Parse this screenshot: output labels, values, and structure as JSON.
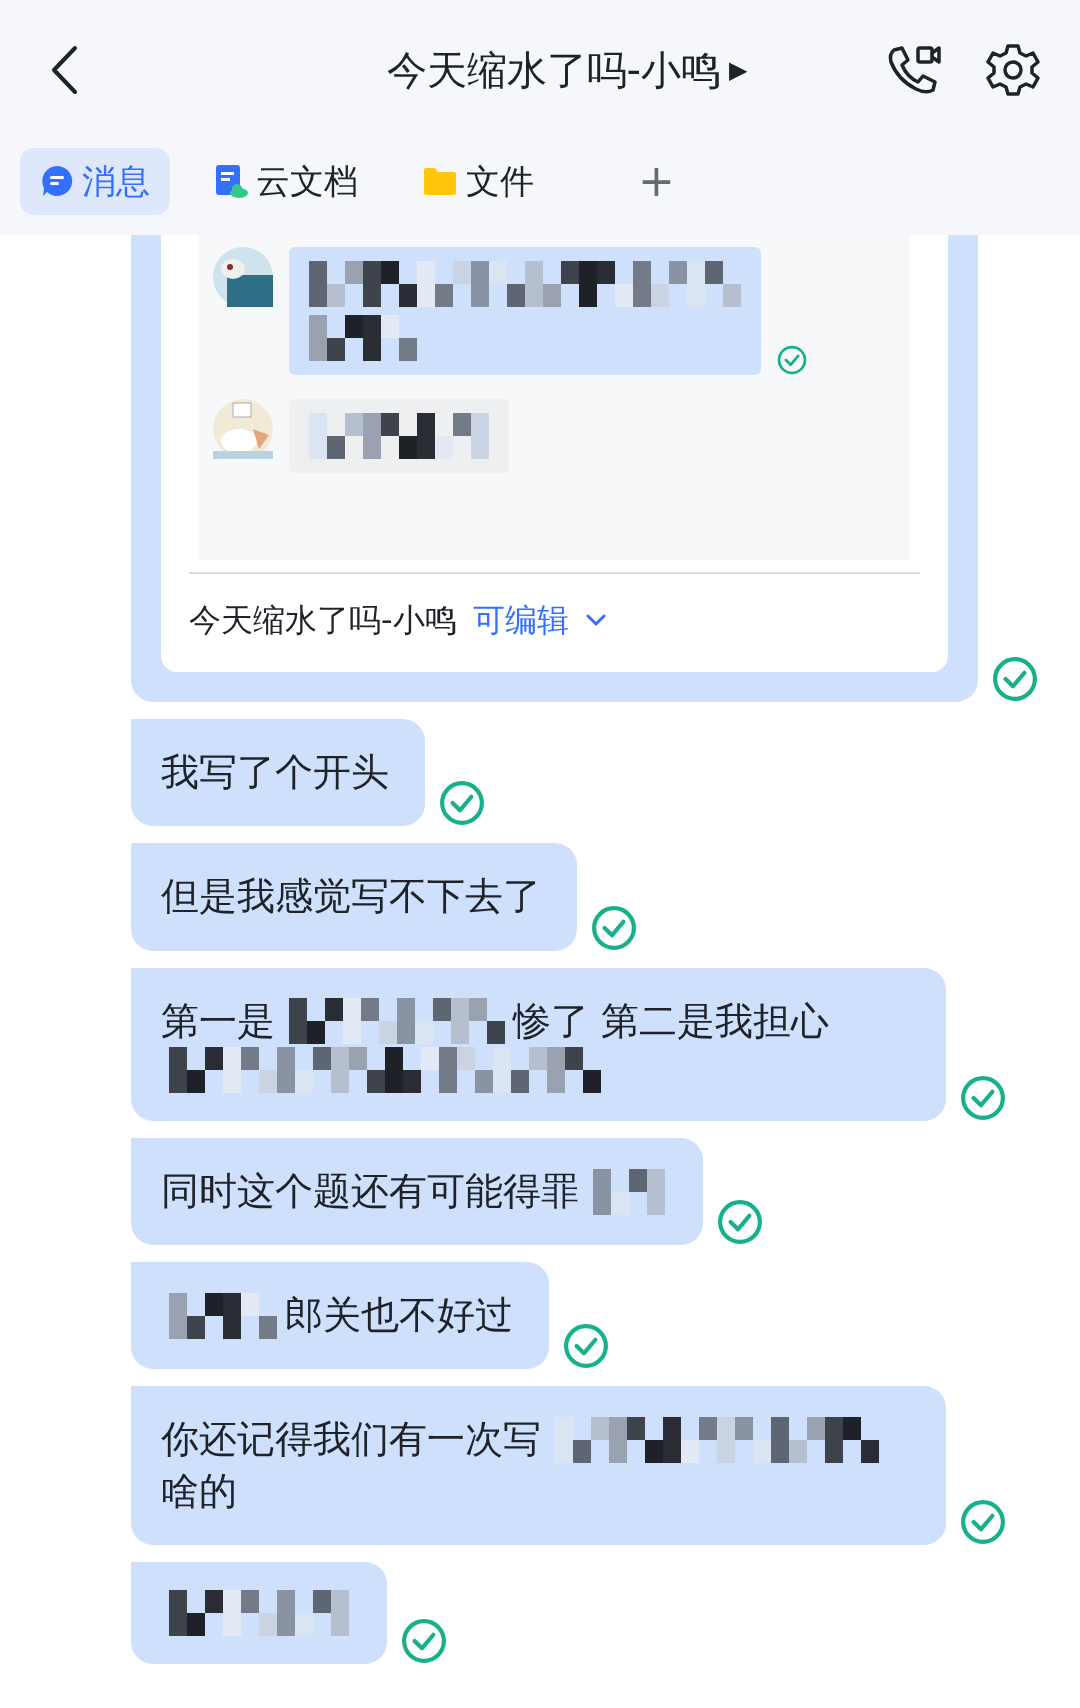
{
  "header": {
    "title": "今天缩水了吗-小鸣",
    "title_caret": "▶"
  },
  "tabs": [
    {
      "label": "消息",
      "kind": "chat",
      "selected": true
    },
    {
      "label": "云文档",
      "kind": "doc",
      "selected": false
    },
    {
      "label": "文件",
      "kind": "folder",
      "selected": false
    },
    {
      "label": "+",
      "kind": "add",
      "selected": false
    }
  ],
  "shared_card": {
    "title": "今天缩水了吗-小鸣",
    "permission": "可编辑",
    "read": true,
    "preview_messages": [
      {
        "mine": true,
        "read": true
      },
      {
        "mine": false,
        "read": false
      }
    ]
  },
  "messages": [
    {
      "read": true,
      "lines": [
        [
          {
            "kind": "text",
            "text": "我写了个开头"
          }
        ]
      ]
    },
    {
      "read": true,
      "lines": [
        [
          {
            "kind": "text",
            "text": "但是我感觉写不下去了"
          }
        ]
      ]
    },
    {
      "read": true,
      "lines": [
        [
          {
            "kind": "text",
            "text": "第一是"
          },
          {
            "kind": "mosaic"
          },
          {
            "kind": "text",
            "text": "惨了 第二是我担心"
          }
        ],
        [
          {
            "kind": "mosaic"
          }
        ]
      ]
    },
    {
      "read": true,
      "lines": [
        [
          {
            "kind": "text",
            "text": "同时这个题还有可能得罪"
          },
          {
            "kind": "mosaic"
          }
        ]
      ]
    },
    {
      "read": true,
      "lines": [
        [
          {
            "kind": "mosaic"
          },
          {
            "kind": "text",
            "text": "郎关也不好过"
          }
        ]
      ]
    },
    {
      "read": true,
      "lines": [
        [
          {
            "kind": "text",
            "text": "你还记得我们有一次写"
          },
          {
            "kind": "mosaic"
          }
        ],
        [
          {
            "kind": "text",
            "text": "啥的"
          }
        ]
      ]
    },
    {
      "read": true,
      "lines": [
        [
          {
            "kind": "mosaic"
          }
        ]
      ]
    }
  ]
}
